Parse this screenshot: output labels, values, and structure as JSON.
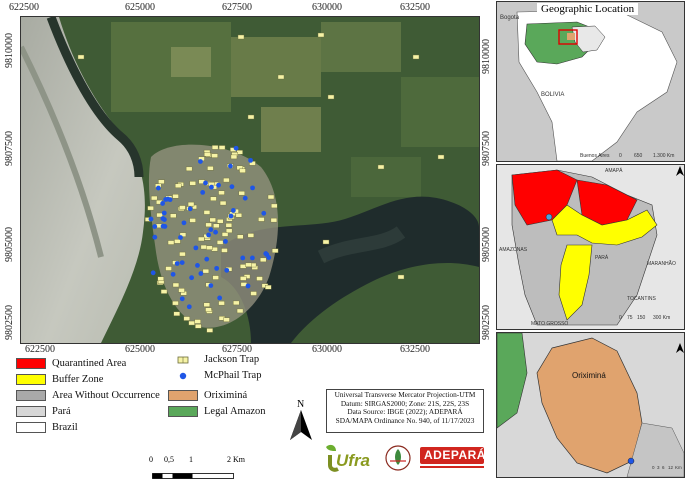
{
  "main_map": {
    "x_ticks": [
      "622500",
      "625000",
      "627500",
      "630000",
      "632500"
    ],
    "y_ticks": [
      "9810000",
      "9807500",
      "9805000",
      "9802500"
    ],
    "trap_counts": {
      "jackson": 120,
      "mcphail": 55
    },
    "colors": {
      "jackson": "#f6f3a6",
      "mcphail": "#1f56e6",
      "water": "#c2c4b9",
      "river": "#1d2a2a",
      "forest": "#3e5a34"
    }
  },
  "inset_1": {
    "title": "Geographic Location",
    "labels": [
      "Bogota",
      "BOLIVIA",
      "Buenos Aires"
    ],
    "scale": [
      "0",
      "650",
      "1.300 Km"
    ]
  },
  "inset_2": {
    "labels": [
      "AMAPÁ",
      "AMAZONAS",
      "PARÁ",
      "MARANHÃO",
      "TOCANTINS",
      "MATO GROSSO"
    ],
    "scale": [
      "0",
      "75",
      "150",
      "300 Km"
    ]
  },
  "inset_3": {
    "label": "Oriximiná",
    "scale": [
      "0",
      "3",
      "6",
      "12",
      "Km"
    ]
  },
  "legend": {
    "col1": [
      "Quarantined Area",
      "Buffer Zone",
      "Area Without Occurrence",
      "Pará",
      "Brazil"
    ],
    "col1_colors": [
      "#ff0000",
      "#ffff00",
      "#a9a9a9",
      "#d7d7d7",
      "#ffffff"
    ],
    "col2_points": [
      "Jackson Trap",
      "McPhail Trap"
    ],
    "col2_areas": [
      "Oriximiná",
      "Legal Amazon"
    ],
    "col2_colors": [
      "#e0a36e",
      "#5aa85a"
    ]
  },
  "north_label": "N",
  "scale_bar": {
    "ticks": [
      "0",
      "0,5",
      "1",
      "2 Km"
    ]
  },
  "info_box": [
    "Universal Transverse Mercator Projection-UTM",
    "Datum: SIRGAS2000; Zone: 21S, 22S, 23S",
    "Data Source: IBGE (2022); ADEPARÁ",
    "SDA/MAPA Ordinance No. 940, of 11/17/2023"
  ],
  "logos": {
    "ufra": "Ufra",
    "adepara": "ADEPARÁ"
  }
}
